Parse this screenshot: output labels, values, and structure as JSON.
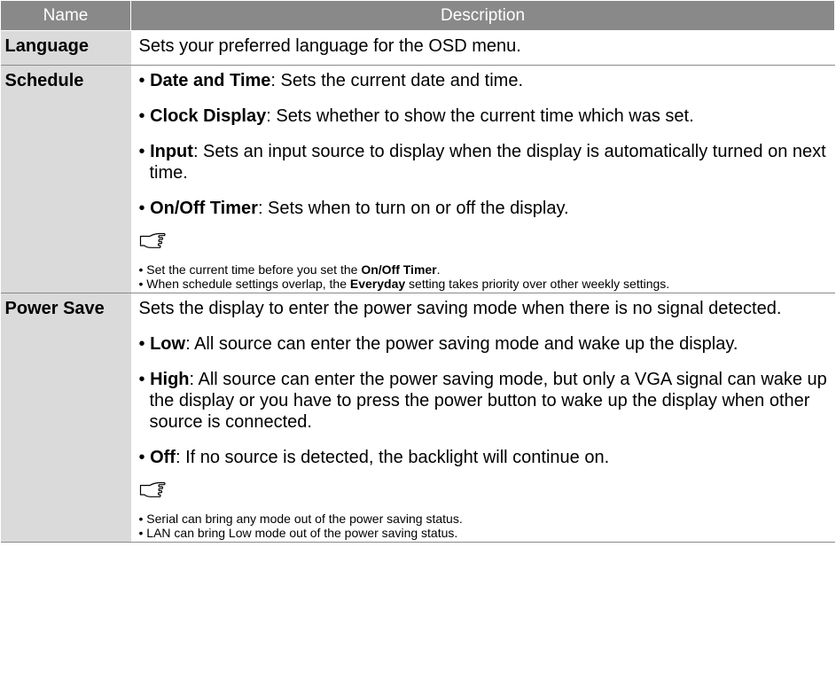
{
  "header": {
    "col_name": "Name",
    "col_description": "Description"
  },
  "language": {
    "name": "Language",
    "description": "Sets your preferred language for the OSD menu."
  },
  "schedule": {
    "name": "Schedule",
    "items": [
      {
        "term": "Date and Time",
        "text": ": Sets the current date and time."
      },
      {
        "term": "Clock Display",
        "text": ": Sets whether to show the current time which was set."
      },
      {
        "term": "Input",
        "text": ": Sets an input source to display when the display is automatically turned on next time."
      },
      {
        "term": "On/Off Timer",
        "text": ": Sets when to turn on or off the display."
      }
    ],
    "note_icon": "pointing-hand-icon",
    "notes": [
      {
        "pre": "Set the current time before you set the ",
        "bold": "On/Off Timer",
        "post": "."
      },
      {
        "pre": "When schedule settings overlap, the ",
        "bold": "Everyday",
        "post": " setting takes priority over other weekly settings."
      }
    ]
  },
  "power_save": {
    "name": "Power Save",
    "intro": "Sets the display to enter the power saving mode when there is no signal detected.",
    "items": [
      {
        "term": "Low",
        "text": ": All source can enter the power saving mode and wake up the display."
      },
      {
        "term": "High",
        "text": ": All source can enter the power saving mode, but only a VGA signal can wake up the display or you have to press the power button to wake up the display when other source is connected."
      },
      {
        "term": "Off",
        "text": ": If no source is detected, the backlight will continue on."
      }
    ],
    "note_icon": "pointing-hand-icon",
    "notes": [
      "Serial can bring any mode out of the power saving status.",
      "LAN can bring Low mode out of the power saving status."
    ]
  }
}
